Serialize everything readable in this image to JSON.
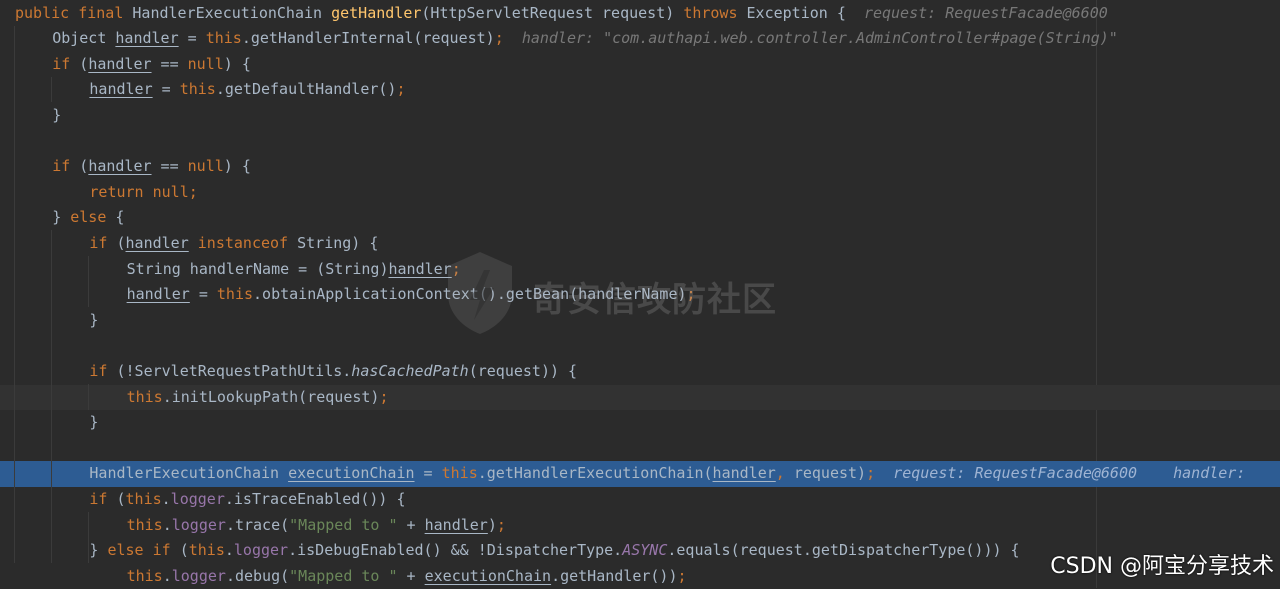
{
  "code_lines": [
    {
      "indent": 0,
      "tokens": [
        [
          "kw",
          "public final "
        ],
        [
          "",
          "HandlerExecutionChain "
        ],
        [
          "fn",
          "getHandler"
        ],
        [
          "",
          "(HttpServletRequest request) "
        ],
        [
          "kw",
          "throws "
        ],
        [
          "",
          "Exception {  "
        ],
        [
          "hint",
          "request: RequestFacade@6600"
        ]
      ]
    },
    {
      "indent": 1,
      "tokens": [
        [
          "",
          "Object "
        ],
        [
          "u",
          "handler"
        ],
        [
          "",
          " = "
        ],
        [
          "kw",
          "this"
        ],
        [
          "",
          ".getHandlerInternal(request)"
        ],
        [
          "kw",
          ";"
        ],
        [
          "",
          "  "
        ],
        [
          "hint",
          "handler: \"com.authapi.web.controller.AdminController#page(String)\""
        ]
      ]
    },
    {
      "indent": 1,
      "tokens": [
        [
          "kw",
          "if "
        ],
        [
          "",
          "("
        ],
        [
          "u",
          "handler"
        ],
        [
          "",
          " == "
        ],
        [
          "kw",
          "null"
        ],
        [
          "",
          ") {"
        ]
      ]
    },
    {
      "indent": 2,
      "tokens": [
        [
          "u",
          "handler"
        ],
        [
          "",
          " = "
        ],
        [
          "kw",
          "this"
        ],
        [
          "",
          ".getDefaultHandler()"
        ],
        [
          "kw",
          ";"
        ]
      ]
    },
    {
      "indent": 1,
      "tokens": [
        [
          "",
          "}"
        ]
      ]
    },
    {
      "indent": 0,
      "tokens": []
    },
    {
      "indent": 1,
      "tokens": [
        [
          "kw",
          "if "
        ],
        [
          "",
          "("
        ],
        [
          "u",
          "handler"
        ],
        [
          "",
          " == "
        ],
        [
          "kw",
          "null"
        ],
        [
          "",
          ") {"
        ]
      ]
    },
    {
      "indent": 2,
      "tokens": [
        [
          "kw",
          "return null;"
        ]
      ]
    },
    {
      "indent": 1,
      "tokens": [
        [
          "",
          "} "
        ],
        [
          "kw",
          "else "
        ],
        [
          "",
          "{"
        ]
      ]
    },
    {
      "indent": 2,
      "tokens": [
        [
          "kw",
          "if "
        ],
        [
          "",
          "("
        ],
        [
          "u",
          "handler"
        ],
        [
          "",
          " "
        ],
        [
          "kw",
          "instanceof "
        ],
        [
          "",
          "String) {"
        ]
      ]
    },
    {
      "indent": 3,
      "tokens": [
        [
          "",
          "String handlerName = (String)"
        ],
        [
          "u",
          "handler"
        ],
        [
          "kw",
          ";"
        ]
      ]
    },
    {
      "indent": 3,
      "tokens": [
        [
          "u",
          "handler"
        ],
        [
          "",
          " = "
        ],
        [
          "kw",
          "this"
        ],
        [
          "",
          ".obtainApplicationContext().getBean(handlerName)"
        ],
        [
          "kw",
          ";"
        ]
      ]
    },
    {
      "indent": 2,
      "tokens": [
        [
          "",
          "}"
        ]
      ]
    },
    {
      "indent": 0,
      "tokens": []
    },
    {
      "indent": 2,
      "tokens": [
        [
          "kw",
          "if "
        ],
        [
          "",
          "(!ServletRequestPathUtils."
        ],
        [
          "mi",
          "hasCachedPath"
        ],
        [
          "",
          "(request)) {"
        ]
      ]
    },
    {
      "indent": 3,
      "tokens": [
        [
          "kw",
          "this"
        ],
        [
          "",
          ".initLookupPath(request)"
        ],
        [
          "kw",
          ";"
        ]
      ]
    },
    {
      "indent": 2,
      "tokens": [
        [
          "",
          "}"
        ]
      ]
    },
    {
      "indent": 0,
      "tokens": []
    },
    {
      "indent": 2,
      "tokens": [
        [
          "",
          "HandlerExecutionChain "
        ],
        [
          "u",
          "executionChain"
        ],
        [
          "",
          " = "
        ],
        [
          "kw",
          "this"
        ],
        [
          "",
          ".getHandlerExecutionChain("
        ],
        [
          "u",
          "handler"
        ],
        [
          "kw",
          ", "
        ],
        [
          "",
          "request)"
        ],
        [
          "kw",
          ";"
        ],
        [
          "",
          "  "
        ],
        [
          "hint",
          "request: RequestFacade@6600    handler: "
        ]
      ]
    },
    {
      "indent": 2,
      "tokens": [
        [
          "kw",
          "if "
        ],
        [
          "",
          "("
        ],
        [
          "kw",
          "this"
        ],
        [
          "",
          "."
        ],
        [
          "fld",
          "logger"
        ],
        [
          "",
          ".isTraceEnabled()) {"
        ]
      ]
    },
    {
      "indent": 3,
      "tokens": [
        [
          "kw",
          "this"
        ],
        [
          "",
          "."
        ],
        [
          "fld",
          "logger"
        ],
        [
          "",
          ".trace("
        ],
        [
          "str",
          "\"Mapped to \""
        ],
        [
          "",
          " + "
        ],
        [
          "u",
          "handler"
        ],
        [
          "",
          ")"
        ],
        [
          "kw",
          ";"
        ]
      ]
    },
    {
      "indent": 2,
      "tokens": [
        [
          "",
          "} "
        ],
        [
          "kw",
          "else if "
        ],
        [
          "",
          "("
        ],
        [
          "kw",
          "this"
        ],
        [
          "",
          "."
        ],
        [
          "fld",
          "logger"
        ],
        [
          "",
          ".isDebugEnabled() && !DispatcherType."
        ],
        [
          "st",
          "ASYNC"
        ],
        [
          "",
          ".equals(request.getDispatcherType())) {"
        ]
      ]
    },
    {
      "indent": 3,
      "tokens": [
        [
          "kw",
          "this"
        ],
        [
          "",
          "."
        ],
        [
          "fld",
          "logger"
        ],
        [
          "",
          ".debug("
        ],
        [
          "str",
          "\"Mapped to \""
        ],
        [
          "",
          " + "
        ],
        [
          "u",
          "executionChain"
        ],
        [
          "",
          ".getHandler())"
        ],
        [
          "kw",
          ";"
        ]
      ]
    }
  ],
  "highlight": {
    "caret_line": 15,
    "execution_line": 18
  },
  "watermark": {
    "text": "奇安信攻防社区",
    "icon": "shield-flame-logo-icon"
  },
  "source_credit": "CSDN @阿宝分享技术",
  "colors": {
    "background": "#2b2b2b",
    "keyword": "#cc7832",
    "method_decl": "#ffc66d",
    "field": "#9876aa",
    "string": "#6a8759",
    "inlay_hint": "#787878",
    "execution_highlight": "#2d5c93"
  }
}
